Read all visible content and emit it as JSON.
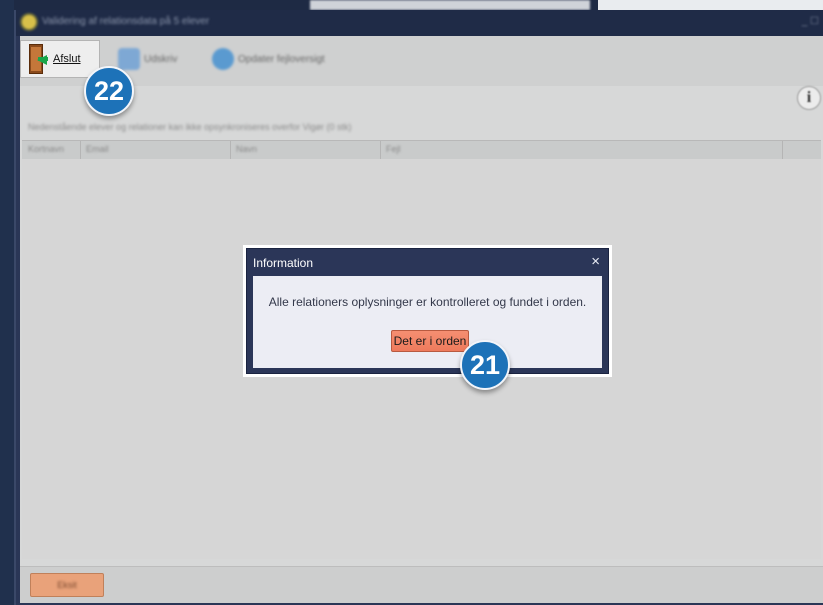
{
  "window": {
    "title": "Validering af relationsdata på 5 elever",
    "controls": "_ ☐"
  },
  "toolbar": {
    "afslut_label": "Afslut",
    "afslut_underline_char": "A",
    "udskriv_label": "Udskriv",
    "opdater_label": "Opdater fejloversigt"
  },
  "info_button_glyph": "i",
  "list": {
    "description": "Nedenstående elever og relationer kan ikke opsynkroniseres overfor Vigør (0 stk)",
    "columns": [
      "Kortnavn",
      "Email",
      "Navn",
      "Fejl"
    ]
  },
  "bottom": {
    "button_label": "Eksit"
  },
  "dialog": {
    "title": "Information",
    "close_glyph": "×",
    "message": "Alle relationers oplysninger er kontrolleret og fundet i orden.",
    "ok_label": "Det er i orden"
  },
  "annotations": {
    "badge_22": "22",
    "badge_21": "21"
  },
  "icons": {
    "afslut": "exit-door-icon",
    "udskriv": "printer-icon",
    "opdater": "refresh-icon",
    "info": "info-icon",
    "app": "app-logo-icon"
  },
  "colors": {
    "dialog_ok_button": "#ef7d60",
    "badge": "#1d72b8",
    "window_frame": "#2a3656"
  }
}
